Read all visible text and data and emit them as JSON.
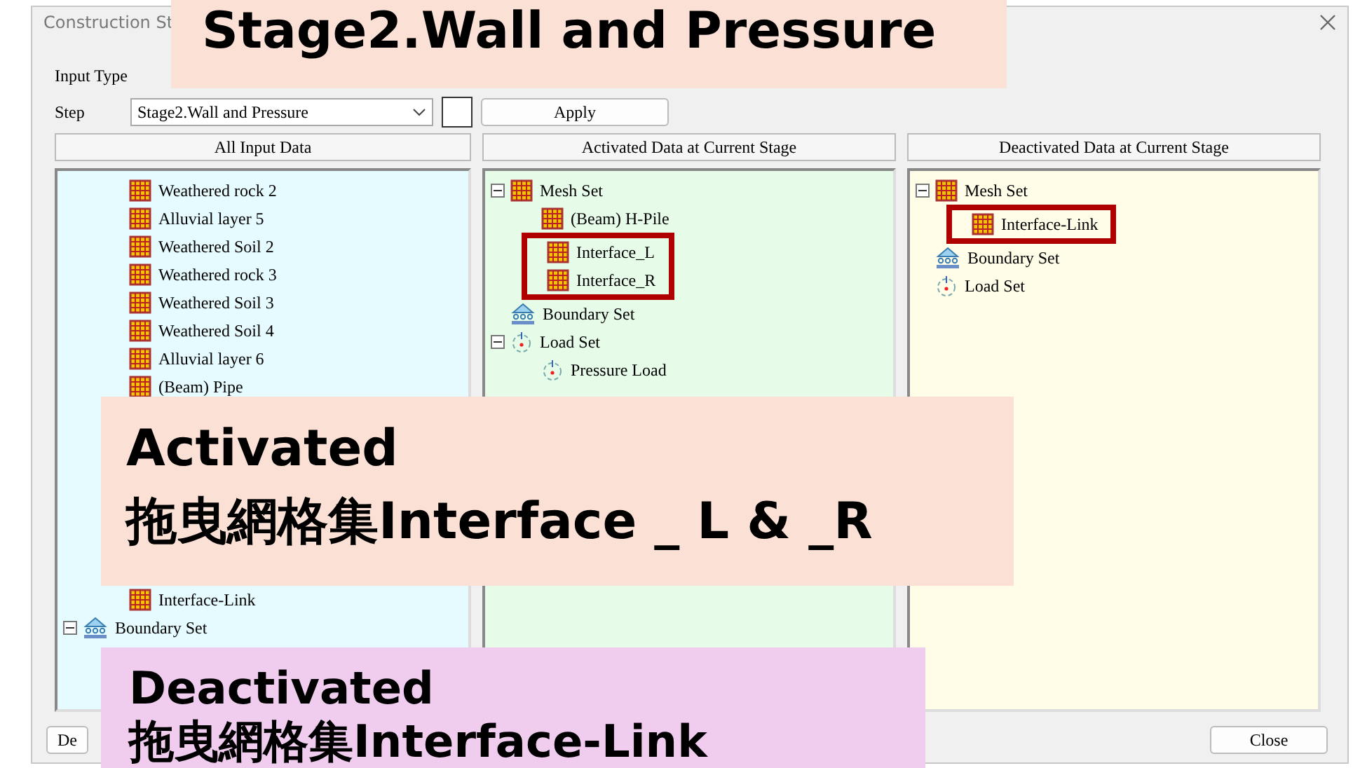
{
  "window": {
    "title": "Construction St"
  },
  "input_type": {
    "label": "Input Type"
  },
  "step": {
    "label": "Step",
    "value": "Stage2.Wall and Pressure",
    "apply": "Apply"
  },
  "columns": [
    "All Input Data",
    "Activated Data at Current Stage",
    "Deactivated Data at Current Stage"
  ],
  "all_input": {
    "upper_items": [
      {
        "label": "Weathered rock 2",
        "kind": "mesh"
      },
      {
        "label": "Alluvial layer 5",
        "kind": "mesh"
      },
      {
        "label": "Weathered Soil 2",
        "kind": "mesh"
      },
      {
        "label": "Weathered rock 3",
        "kind": "mesh"
      },
      {
        "label": "Weathered Soil 3",
        "kind": "mesh"
      },
      {
        "label": "Weathered Soil 4",
        "kind": "mesh"
      },
      {
        "label": "Alluvial layer 6",
        "kind": "mesh"
      },
      {
        "label": "(Beam) Pipe",
        "kind": "mesh"
      }
    ],
    "lower_items": [
      {
        "label": "Interface-Link",
        "kind": "mesh"
      }
    ],
    "roots": [
      {
        "label": "Boundary Set",
        "kind": "boundary",
        "expanded": true
      }
    ]
  },
  "activated": [
    {
      "label": "Mesh Set",
      "kind": "mesh",
      "expanded": true,
      "children": [
        {
          "label": "(Beam) H-Pile",
          "kind": "mesh",
          "highlighted": false
        },
        {
          "label": "Interface_L",
          "kind": "mesh",
          "highlighted": true
        },
        {
          "label": "Interface_R",
          "kind": "mesh",
          "highlighted": true
        }
      ]
    },
    {
      "label": "Boundary Set",
      "kind": "boundary"
    },
    {
      "label": "Load Set",
      "kind": "load",
      "expanded": true,
      "children": [
        {
          "label": "Pressure Load",
          "kind": "load",
          "highlighted": false
        }
      ]
    }
  ],
  "deactivated": [
    {
      "label": "Mesh Set",
      "kind": "mesh",
      "expanded": true,
      "children": [
        {
          "label": "Interface-Link",
          "kind": "mesh",
          "highlighted": true
        }
      ]
    },
    {
      "label": "Boundary Set",
      "kind": "boundary"
    },
    {
      "label": "Load Set",
      "kind": "load"
    }
  ],
  "buttons": {
    "left": "De",
    "close": "Close"
  },
  "callouts": [
    {
      "kind": "top",
      "lines": [
        "Stage2.Wall and Pressure"
      ]
    },
    {
      "kind": "middle",
      "lines": [
        "Activated",
        "拖曳網格集Interface _ L & _R"
      ]
    },
    {
      "kind": "bottom",
      "lines": [
        "Deactivated",
        "拖曳網格集Interface-Link"
      ]
    }
  ]
}
